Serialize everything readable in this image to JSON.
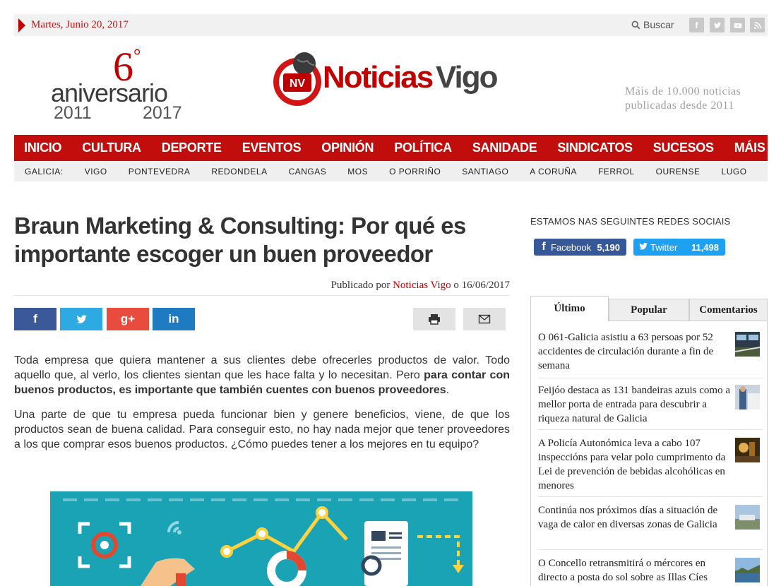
{
  "topbar": {
    "date": "Martes, Junio 20, 2017",
    "search_label": "Buscar",
    "social_icons": [
      "facebook-icon",
      "twitter-icon",
      "youtube-icon",
      "rss-icon"
    ]
  },
  "header": {
    "anniversary_number": "6",
    "anniversary_degree": "°",
    "anniversary_word": "aniversario",
    "anniversary_year_start": "2011",
    "anniversary_year_end": "2017",
    "logo_part1": "Noticias",
    "logo_part2": "Vigo",
    "logo_badge": "NV",
    "tagline": "Máis de 10.000 noticias publicadas desde 2011"
  },
  "nav": {
    "main": [
      "INICIO",
      "CULTURA",
      "DEPORTE",
      "EVENTOS",
      "OPINIÓN",
      "POLÍTICA",
      "SANIDADE",
      "SINDICATOS",
      "SUCESOS",
      "MÁIS"
    ],
    "sub_label": "GALICIA:",
    "sub": [
      "VIGO",
      "PONTEVEDRA",
      "REDONDELA",
      "CANGAS",
      "MOS",
      "O PORRIÑO",
      "SANTIAGO",
      "A CORUÑA",
      "FERROL",
      "OURENSE",
      "LUGO"
    ]
  },
  "article": {
    "title": "Braun Marketing & Consulting: Por qué es importante escoger un buen proveedor",
    "byline_prefix": "Publicado por",
    "author": "Noticias Vigo",
    "byline_mid": "o",
    "date": "16/06/2017",
    "share": {
      "facebook": "f",
      "twitter": "twitter-icon",
      "gplus": "g+",
      "linkedin": "in"
    },
    "p1_text": "Toda empresa que quiera mantener a sus clientes debe ofrecerles productos de valor. Todo aquello que, al verlo, los clientes sientan que les hace falta y lo necesitan. Pero ",
    "p1_bold": "para contar con buenos productos, es importante que también cuentes con buenos proveedores",
    "p1_end": ".",
    "p2": "Una parte de que tu empresa pueda funcionar bien y genere beneficios, viene, de que los productos sean de buena calidad. Para conseguir esto, no hay nada mejor que tener proveedores a los que comprar esos buenos productos. ¿Cómo puedes tener a los mejores en tu equipo?"
  },
  "sidebar": {
    "social_heading": "ESTAMOS NAS SEGUINTES REDES SOCIAIS",
    "facebook_label": "Facebook",
    "facebook_count": "5,190",
    "twitter_label": "Twitter",
    "twitter_count": "11,498",
    "tabs": [
      "Último",
      "Popular",
      "Comentarios"
    ],
    "items": [
      {
        "title": "O 061-Galicia asistiu a 63 persoas por 52 accidentes de circulación durante a fin de semana"
      },
      {
        "title": "Feijóo destaca as 131 bandeiras azuis como a mellor porta de entrada para descubrir a riqueza natural de Galicia"
      },
      {
        "title": "A Policía Autonómica leva a cabo 107 inspeccións para velar polo cumprimento da Lei de prevención de bebidas alcohólicas en menores"
      },
      {
        "title": "Continúa nos próximos días a situación de vaga de calor en diversas zonas de Galicia"
      },
      {
        "title": "O Concello retransmitirá o mércores en directo a posta do sol sobre as Illas Cíes"
      }
    ]
  },
  "colors": {
    "brand_red": "#c20d0d",
    "facebook": "#3b5998",
    "twitter": "#2daae1",
    "gplus": "#e94b3c",
    "linkedin": "#1f7bc1"
  }
}
